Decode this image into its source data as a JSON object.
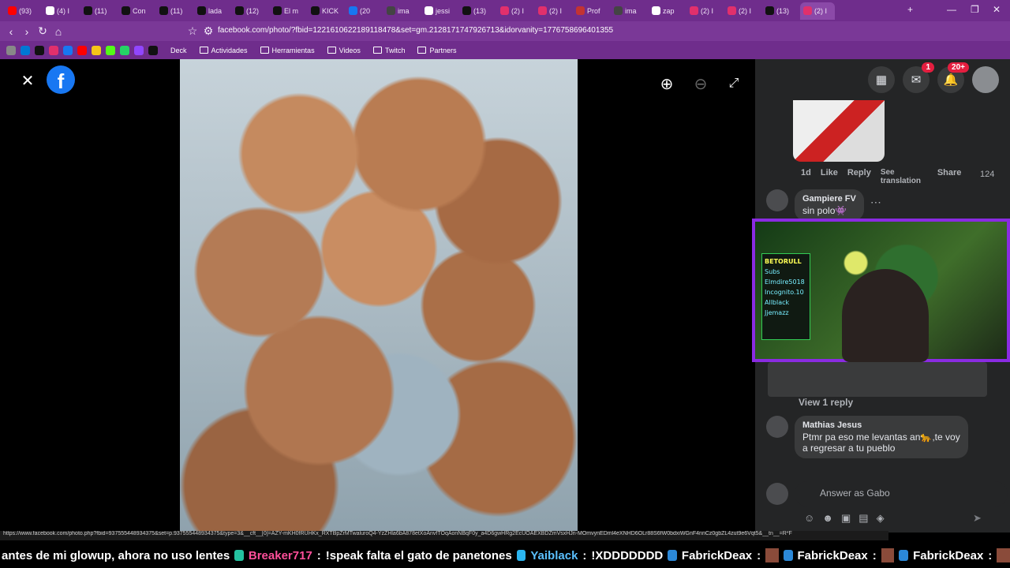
{
  "browser": {
    "tabs": [
      {
        "label": "(93)",
        "color": "#ff0000"
      },
      {
        "label": "(4) I",
        "color": "#ffffff"
      },
      {
        "label": "(11)",
        "color": "#111111"
      },
      {
        "label": "Con",
        "color": "#111111"
      },
      {
        "label": "(11)",
        "color": "#111111"
      },
      {
        "label": "lada",
        "color": "#111111"
      },
      {
        "label": "(12)",
        "color": "#111111"
      },
      {
        "label": "El m",
        "color": "#111111"
      },
      {
        "label": "KICK",
        "color": "#111111"
      },
      {
        "label": "(20",
        "color": "#1877f2"
      },
      {
        "label": "ima",
        "color": "#444444"
      },
      {
        "label": "jessi",
        "color": "#ffffff"
      },
      {
        "label": "(13)",
        "color": "#111111"
      },
      {
        "label": "(2) I",
        "color": "#e1306c"
      },
      {
        "label": "(2) I",
        "color": "#e1306c"
      },
      {
        "label": "Prof",
        "color": "#c33333"
      },
      {
        "label": "ima",
        "color": "#444444"
      },
      {
        "label": "zap",
        "color": "#ffffff"
      },
      {
        "label": "(2) I",
        "color": "#e1306c"
      },
      {
        "label": "(2) I",
        "color": "#e1306c"
      },
      {
        "label": "(13)",
        "color": "#111111"
      },
      {
        "label": "(2) I",
        "color": "#e1306c"
      }
    ],
    "url": "facebook.com/photo/?fbid=1221610622189118478&set=gm.2128171747926713&idorvanity=1776758696401355",
    "bookmarks_folders": [
      "Deck",
      "Actividades",
      "Herramientas",
      "Videos",
      "Twitch",
      "Partners"
    ],
    "status_url": "https://www.facebook.com/photo.php?fbid=937555448934375&set=p.937555448934375&type=3&__cft__[0]=AZY-mKH0fRUHKx_RXTBpZrMTwaluroQ4-YzZHla6bA878etXoAnvfTOqAonNBqF0y_a4D6gwHRg2EcUOAEXBDZmVsxHJn-MOmvynEDml4eXNHD6OLr88S6fW0bdxiWGnF4nnCz0gbZL4zut9e6Vqt5&__tn__=R*F"
  },
  "viewer": {
    "close_icon": "close-icon",
    "logo_letter": "f",
    "zoom_in_icon": "zoom-in-icon",
    "zoom_out_icon": "zoom-out-icon",
    "fullscreen_icon": "fullscreen-icon"
  },
  "sidebar": {
    "notifications": {
      "messenger_badge": "1",
      "bell_badge": "20+"
    },
    "actions": {
      "time": "1d",
      "like": "Like",
      "reply": "Reply",
      "see_translation": "See translation",
      "share": "Share",
      "reaction_count": "124"
    },
    "comments": [
      {
        "name": "Gampiere FV",
        "text": "sin polo👾"
      },
      {
        "name": "Mathias Jesus",
        "text": "Ptmr pa eso me levantas an🐆,te voy a regresar a tu pueblo"
      }
    ],
    "view_reply": "View 1 reply",
    "composer_placeholder": "Answer as Gabo"
  },
  "stream_overlay": {
    "chalkboard_lines": [
      "BETORULL",
      "Subs",
      "Elmdire5018",
      "Incognito.10",
      "Allblack",
      "Jjemazz"
    ]
  },
  "ticker": {
    "items": [
      {
        "user": "",
        "text": "antes de mi glowup, ahora no uso lentes"
      },
      {
        "user": "Breaker717",
        "text": "!speak falta el gato de panetones"
      },
      {
        "user": "Yaiblack",
        "text": "!XDDDDDDD"
      },
      {
        "user": "FabrickDeax",
        "text": ""
      },
      {
        "user": "FabrickDeax",
        "text": ""
      },
      {
        "user": "FabrickDeax",
        "text": ""
      }
    ]
  }
}
